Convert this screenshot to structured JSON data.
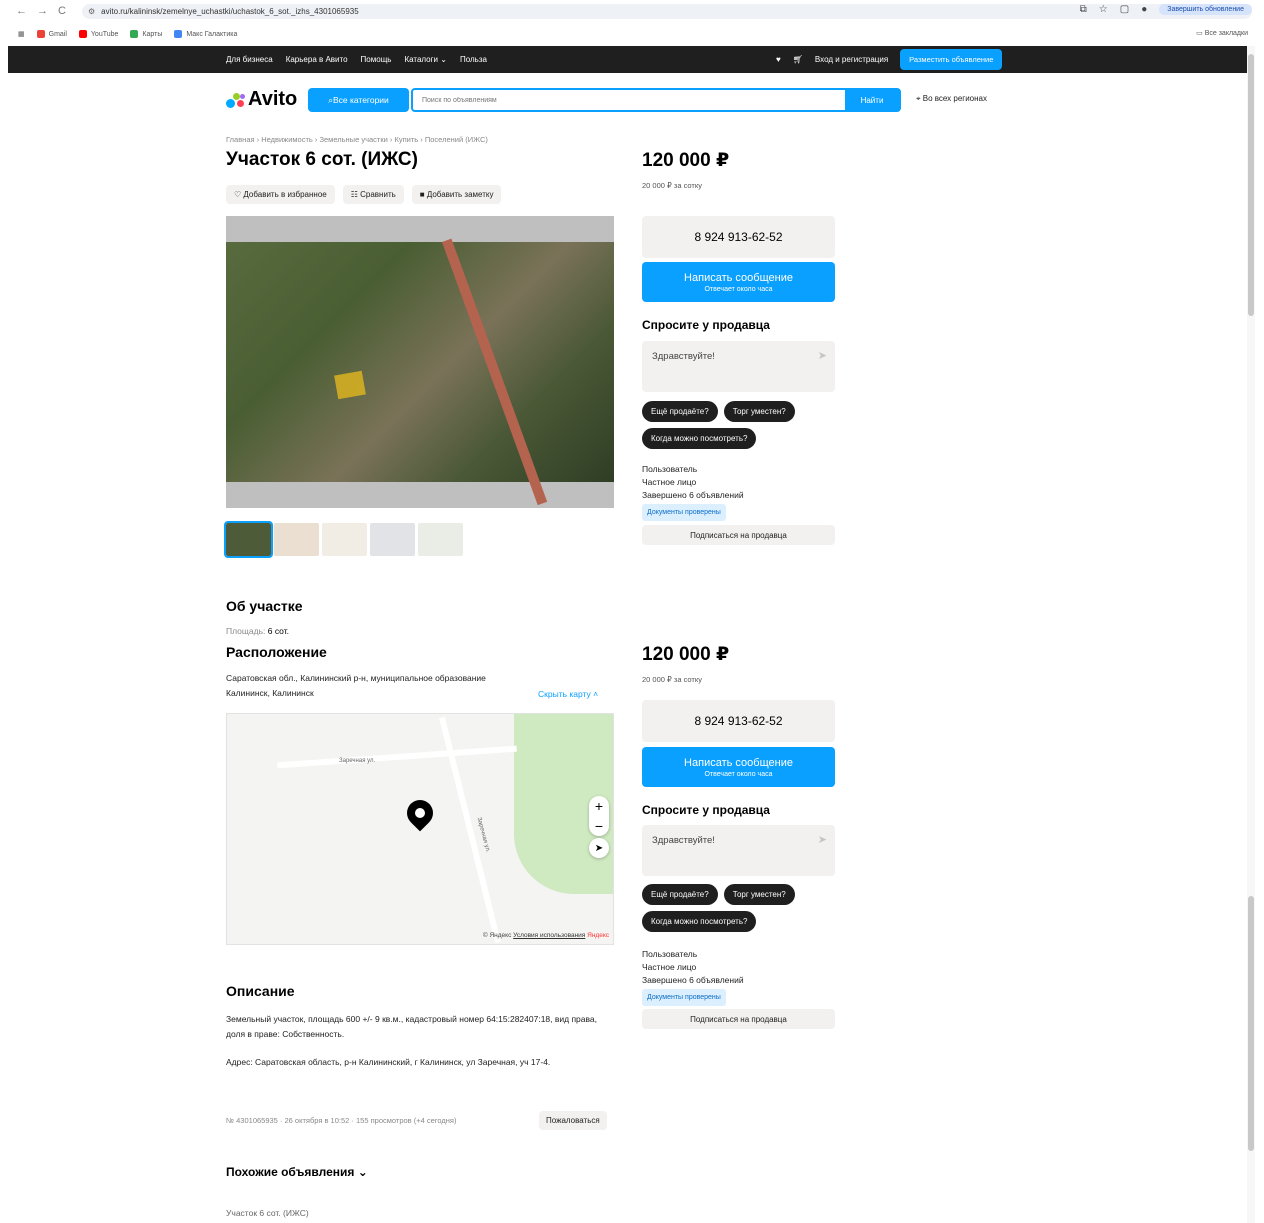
{
  "browser": {
    "url": "avito.ru/kalininsk/zemelnye_uchastki/uchastok_6_sot._izhs_4301065935",
    "update_label": "Завершить обновление",
    "bookmarks": [
      "Gmail",
      "YouTube",
      "Карты",
      "Макс Галактика"
    ],
    "bookmarks_right": "Все закладки"
  },
  "topbar": {
    "links": [
      "Для бизнеса",
      "Карьера в Авито",
      "Помощь",
      "Каталоги",
      "Польза"
    ],
    "login": "Вход и регистрация",
    "post": "Разместить объявление"
  },
  "header": {
    "logo": "Avito",
    "categories": "Все категории",
    "search_placeholder": "Поиск по объявлениям",
    "search_button": "Найти",
    "region": "Во всех регионах"
  },
  "listing": {
    "breadcrumb": "Главная › Недвижимость › Земельные участки › Купить › Поселений (ИЖС)",
    "title": "Участок 6 сот. (ИЖС)",
    "actions": [
      "Добавить в избранное",
      "Сравнить",
      "Добавить заметку"
    ],
    "about_title": "Об участке",
    "area_label": "Площадь:",
    "area_value": "6 сот.",
    "location_title": "Расположение",
    "address": "Саратовская обл., Калининский р-н, муниципальное образование Калининск, Калининск",
    "hide_map": "Скрыть карту",
    "map_copyright": "© Яндекс",
    "map_terms": "Условия использования",
    "map_brand": "Яндекс",
    "map_street_1": "Заречная ул.",
    "map_street_2": "Заречная ул.",
    "description_title": "Описание",
    "description": "Земельный участок, площадь 600 +/- 9 кв.м., кадастровый номер 64:15:282407:18, вид права, доля в праве: Собственность.",
    "description_address": "Адрес: Саратовская область, р-н Калининский, г Калининск, ул Заречная, уч 17-4.",
    "meta": "№ 4301065935 · 26 октября в 10:52 · 155 просмотров (+4 сегодня)",
    "report": "Пожаловаться",
    "similar_title": "Похожие объявления",
    "similar_item": "Участок 6 сот. (ИЖС)"
  },
  "sidebar": {
    "price": "120 000 ₽",
    "price_per": "20 000 ₽ за сотку",
    "phone": "8 924 913-62-52",
    "message": "Написать сообщение",
    "message_sub": "Отвечает около часа",
    "ask_title": "Спросите у продавца",
    "ask_placeholder": "Здравствуйте!",
    "chips": [
      "Ещё продаёте?",
      "Торг уместен?",
      "Когда можно посмотреть?"
    ],
    "seller_role": "Пользователь",
    "seller_type": "Частное лицо",
    "seller_done": "Завершено 6 объявлений",
    "seller_verified": "Документы проверены",
    "subscribe": "Подписаться на продавца"
  },
  "colors": {
    "accent": "#0aa0ff",
    "dark": "#1f1f1f",
    "panel": "#f2f1ef"
  }
}
